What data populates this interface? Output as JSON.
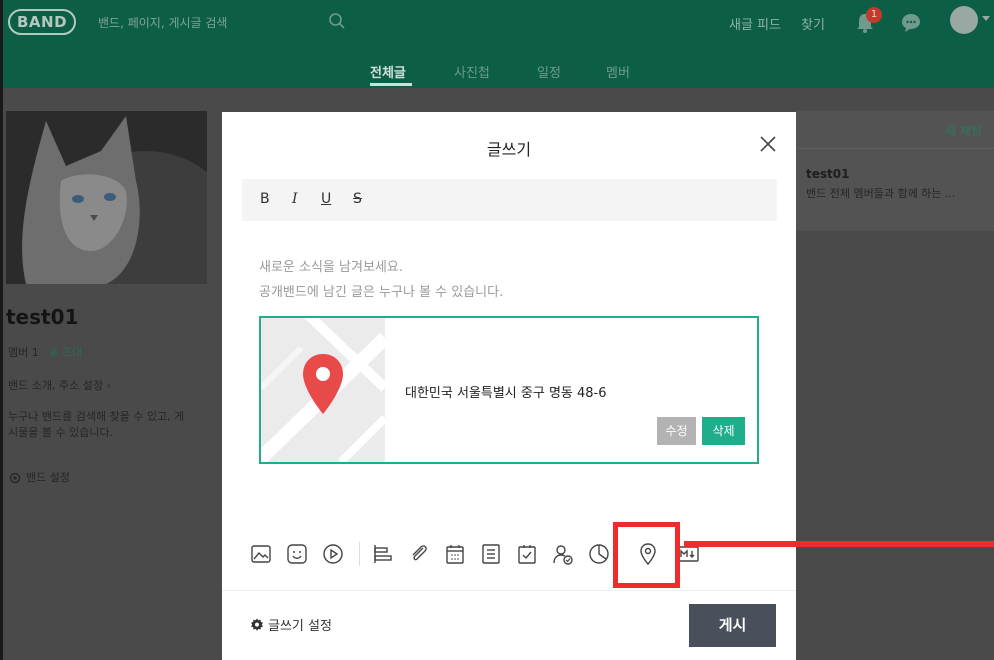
{
  "app": {
    "logo": "BAND",
    "search_placeholder": "밴드, 페이지, 게시글 검색",
    "links": {
      "new_feed": "새글 피드",
      "find": "찾기"
    },
    "notification_count": "1"
  },
  "tabs": [
    {
      "label": "전체글",
      "active": true
    },
    {
      "label": "사진첩",
      "active": false
    },
    {
      "label": "일정",
      "active": false
    },
    {
      "label": "멤버",
      "active": false
    }
  ],
  "band": {
    "name": "test01",
    "member_label": "멤버 1",
    "invite_label": "조대",
    "intro_link": "밴드 소개, 주소 설정",
    "intro_line1": "누구나 밴드를 검색해 찾을 수 있고, 게",
    "intro_line2": "시물을 볼 수 있습니다.",
    "settings_label": "밴드 설정"
  },
  "chat": {
    "new_chat": "새 채팅",
    "item_name": "test01",
    "item_desc": "밴드 전체 멤버들과 함께 하는 ..."
  },
  "modal": {
    "title": "글쓰기",
    "format": {
      "bold": "B",
      "italic": "I",
      "underline": "U",
      "strike": "S"
    },
    "placeholder_line1": "새로운 소식을 남겨보세요.",
    "placeholder_line2": "공개밴드에 남긴 글은 누구나 볼 수 있습니다.",
    "location": {
      "address": "대한민국 서울특별시 중구 명동 48-6",
      "edit_label": "수정",
      "delete_label": "삭제"
    },
    "toolbar_icons": [
      "image-icon",
      "sticker-icon",
      "video-icon",
      "list-icon",
      "attach-icon",
      "calendar-icon",
      "todo-icon",
      "checkbox-icon",
      "person-icon",
      "pie-icon",
      "location-icon",
      "markdown-icon"
    ],
    "settings_label": "글쓰기 설정",
    "post_label": "게시"
  },
  "colors": {
    "brand": "#00a86b",
    "accent": "#1fae8c",
    "highlight": "#ee2c2c",
    "post_button": "#4a4f5c"
  }
}
